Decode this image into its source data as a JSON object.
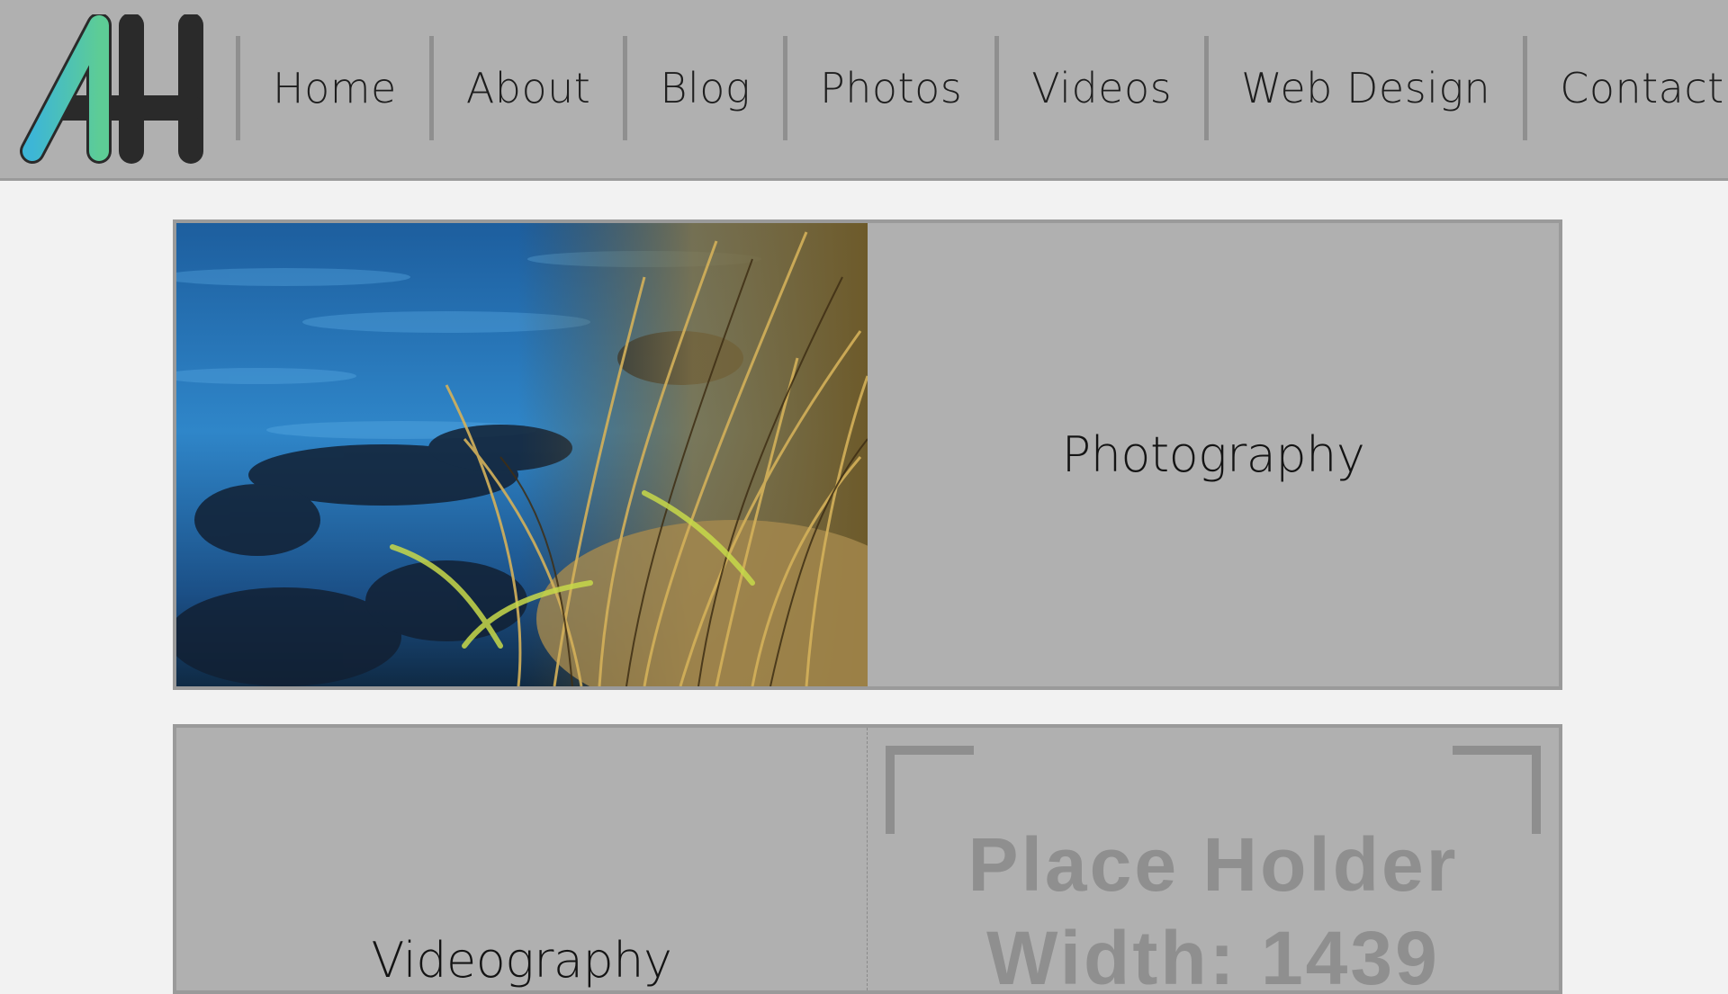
{
  "logo": {
    "text": "AH",
    "gradient_start": "#3db6d6",
    "gradient_end": "#5dcc96",
    "outline": "#2a2a2a"
  },
  "nav": {
    "items": [
      {
        "label": "Home"
      },
      {
        "label": "About"
      },
      {
        "label": "Blog"
      },
      {
        "label": "Photos"
      },
      {
        "label": "Videos"
      },
      {
        "label": "Web Design"
      },
      {
        "label": "Contact"
      }
    ]
  },
  "cards": [
    {
      "label": "Photography",
      "image": "grass-by-water-photo"
    },
    {
      "label": "Videography",
      "placeholder_line1": "Place Holder",
      "placeholder_line2": "Width: 1439"
    }
  ],
  "colors": {
    "header_bg": "#b0b0b0",
    "page_bg": "#f2f2f2",
    "card_bg": "#b0b0b0",
    "text": "#1e1e1e"
  }
}
